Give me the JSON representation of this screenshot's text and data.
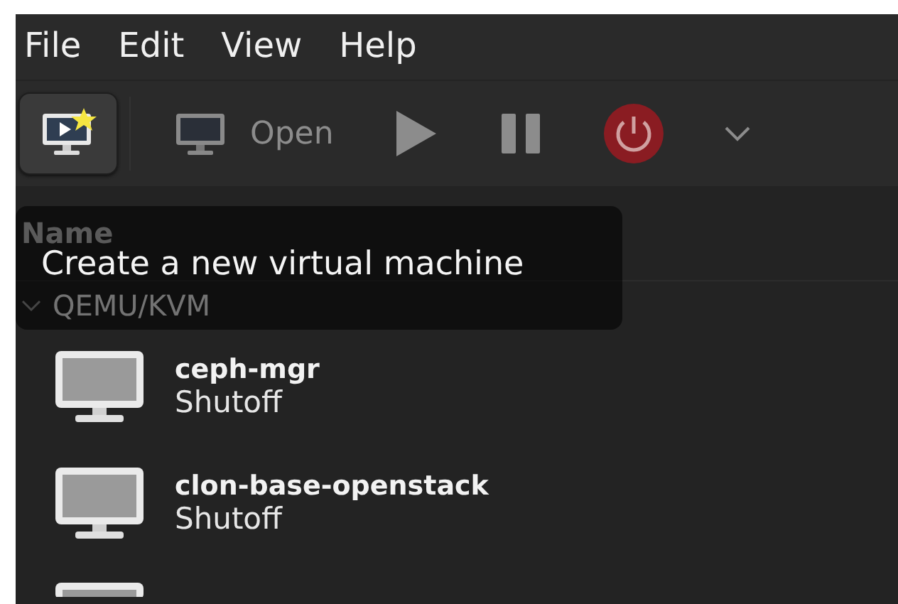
{
  "menu": [
    "File",
    "Edit",
    "View",
    "Help"
  ],
  "toolbar": [
    {
      "kind": "new",
      "selected": true
    },
    {
      "kind": "open",
      "label": "Open",
      "selected": false
    },
    {
      "kind": "run",
      "selected": false
    },
    {
      "kind": "pause",
      "selected": false
    },
    {
      "kind": "shutdown",
      "selected": false
    },
    {
      "kind": "dropdown",
      "selected": false
    }
  ],
  "tooltip": "Create a new virtual machine",
  "table": {
    "column_1": "Name",
    "group": {
      "label": "QEMU/KVM",
      "expanded": true,
      "vms": [
        {
          "name": "ceph-mgr",
          "status": "Shutoff"
        },
        {
          "name": "clon-base-openstack",
          "status": "Shutoff"
        }
      ]
    }
  }
}
